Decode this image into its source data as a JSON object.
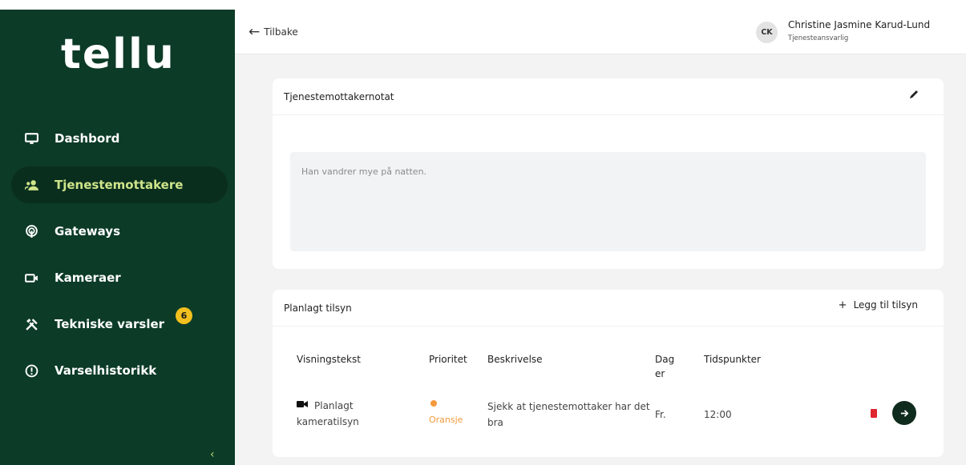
{
  "brand": {
    "logo": "tellu"
  },
  "sidebar": {
    "items": [
      {
        "label": "Dashbord",
        "icon": "monitor-icon"
      },
      {
        "label": "Tjenestemottakere",
        "icon": "users-icon",
        "active": true
      },
      {
        "label": "Gateways",
        "icon": "broadcast-icon"
      },
      {
        "label": "Kameraer",
        "icon": "camera-icon"
      },
      {
        "label": "Tekniske varsler",
        "icon": "tools-icon",
        "badge": "6"
      },
      {
        "label": "Varselhistorikk",
        "icon": "alert-circle-icon"
      }
    ],
    "collapse": "‹"
  },
  "topbar": {
    "back_label": "Tilbake",
    "user_initials": "CK",
    "user_name": "Christine Jasmine Karud-Lund",
    "user_role": "Tjenesteansvarlig"
  },
  "note_card": {
    "title": "Tjenestemottakernotat",
    "text": "Han vandrer mye på natten."
  },
  "plan_card": {
    "title": "Planlagt tilsyn",
    "add_label": "Legg til tilsyn",
    "columns": [
      "Visningstekst",
      "Prioritet",
      "Beskrivelse",
      "Dag er",
      "Tidspunkter"
    ],
    "rows": [
      {
        "display": "Planlagt kameratilsyn",
        "priority": "Oransje",
        "description": "Sjekk at tjenestemottaker har det bra",
        "days": "Fr.",
        "time": "12:00"
      }
    ]
  },
  "colors": {
    "sidebar_bg": "#0c3b27",
    "active_text": "#cfe58a",
    "badge": "#f2c01f",
    "priority_orange": "#f29a3d",
    "delete_red": "#e0252f"
  }
}
